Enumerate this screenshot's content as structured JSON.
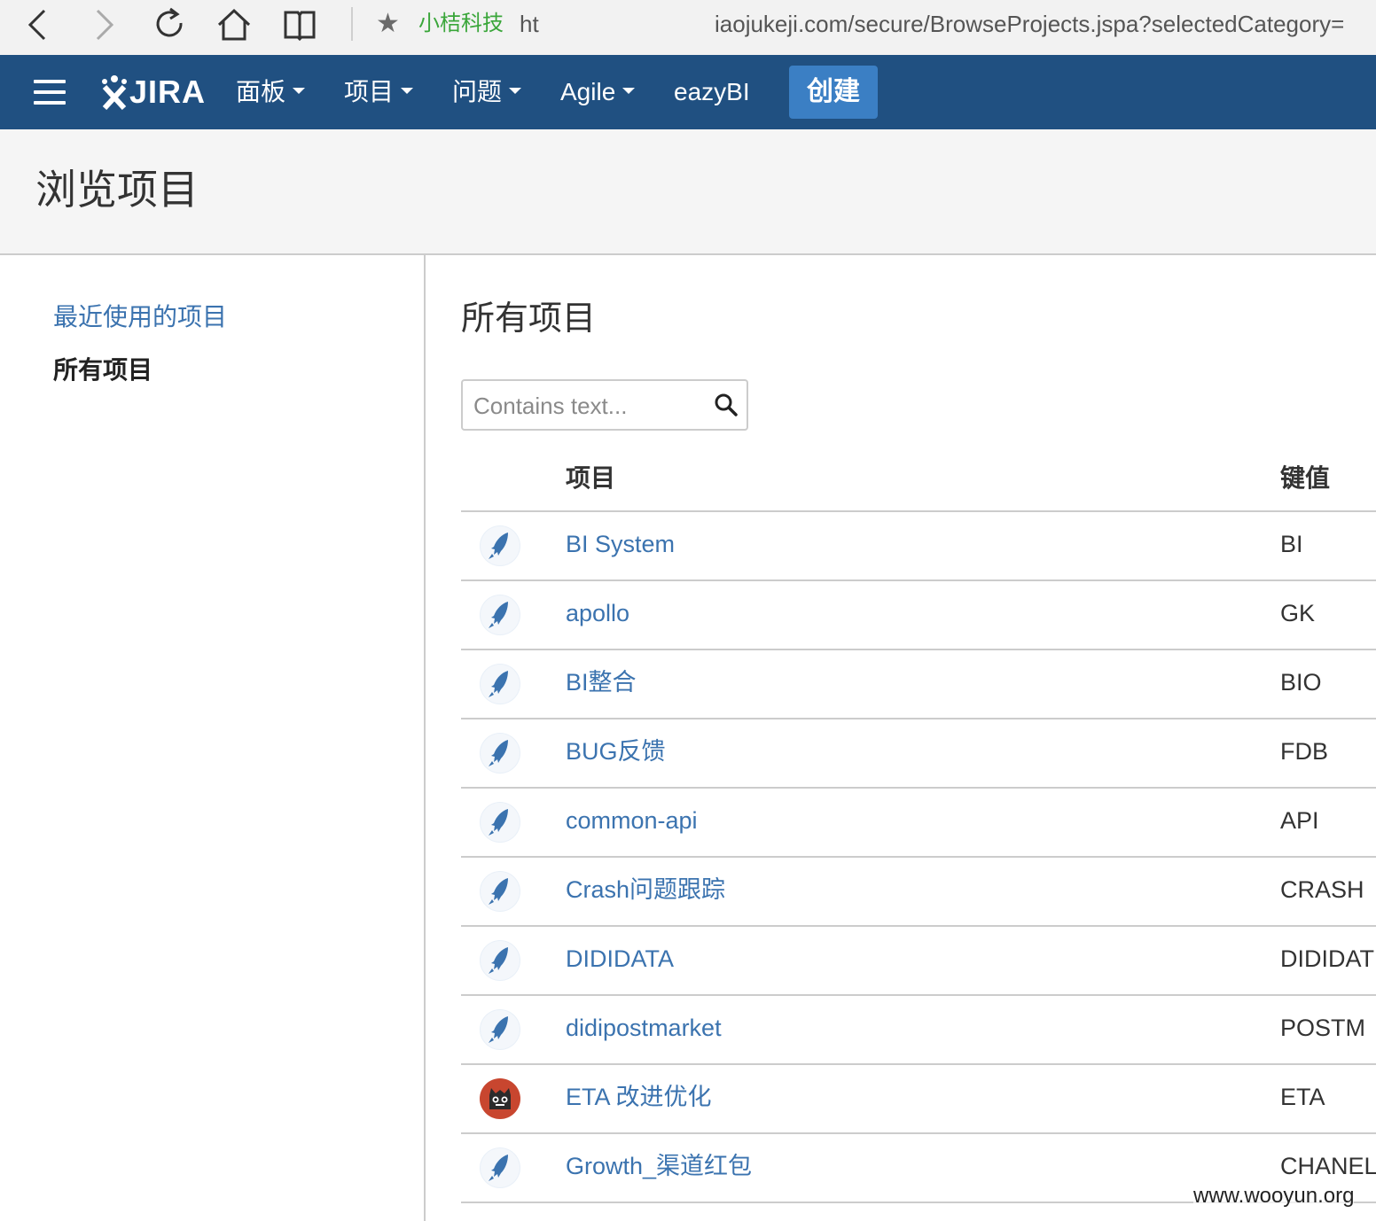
{
  "browser": {
    "favorite_label": "小桔科技",
    "favorite_suffix": "ht",
    "url": "iaojukeji.com/secure/BrowseProjects.jspa?selectedCategory="
  },
  "header": {
    "logo_text": "JIRA",
    "nav": [
      {
        "label": "面板",
        "dropdown": true
      },
      {
        "label": "项目",
        "dropdown": true
      },
      {
        "label": "问题",
        "dropdown": true
      },
      {
        "label": "Agile",
        "dropdown": true
      },
      {
        "label": "eazyBI",
        "dropdown": false
      }
    ],
    "create_label": "创建",
    "colors": {
      "bar": "#205081",
      "create": "#3b7fc4"
    }
  },
  "page": {
    "title": "浏览项目"
  },
  "sidebar": {
    "items": [
      {
        "label": "最近使用的项目",
        "active": false
      },
      {
        "label": "所有项目",
        "active": true
      }
    ]
  },
  "main": {
    "section_title": "所有项目",
    "search": {
      "placeholder": "Contains text...",
      "value": ""
    },
    "columns": {
      "name": "项目",
      "key": "键值"
    },
    "projects": [
      {
        "name": "BI System",
        "key": "BI",
        "avatar": "rocket-avatar-icon"
      },
      {
        "name": "apollo",
        "key": "GK",
        "avatar": "rocket-avatar-icon"
      },
      {
        "name": "BI整合",
        "key": "BIO",
        "avatar": "rocket-avatar-icon"
      },
      {
        "name": "BUG反馈",
        "key": "FDB",
        "avatar": "rocket-avatar-icon"
      },
      {
        "name": "common-api",
        "key": "API",
        "avatar": "rocket-avatar-icon"
      },
      {
        "name": "Crash问题跟踪",
        "key": "CRASH",
        "avatar": "rocket-avatar-icon"
      },
      {
        "name": "DIDIDATA",
        "key": "DIDIDAT",
        "avatar": "rocket-avatar-icon"
      },
      {
        "name": "didipostmarket",
        "key": "POSTM",
        "avatar": "rocket-avatar-icon"
      },
      {
        "name": "ETA 改进优化",
        "key": "ETA",
        "avatar": "monster-avatar-icon"
      },
      {
        "name": "Growth_渠道红包",
        "key": "CHANEL",
        "avatar": "rocket-avatar-icon"
      }
    ],
    "link_color": "#3b73af"
  },
  "watermark": "www.wooyun.org"
}
